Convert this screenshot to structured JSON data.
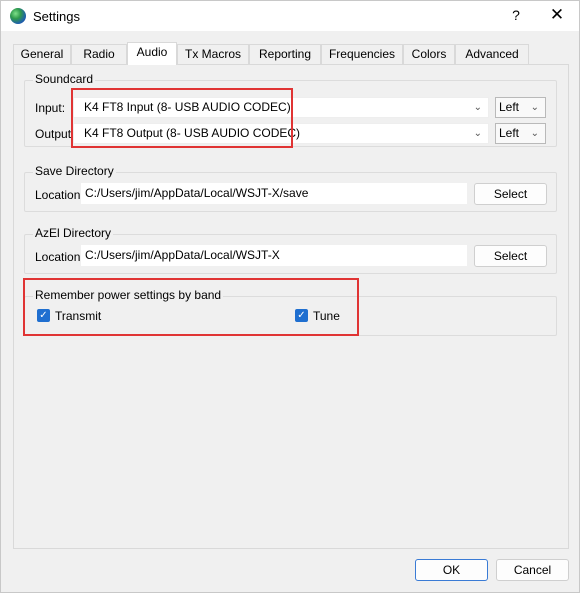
{
  "window": {
    "title": "Settings",
    "help": "?",
    "close": "✕"
  },
  "tabs": [
    {
      "label": "General"
    },
    {
      "label": "Radio"
    },
    {
      "label": "Audio"
    },
    {
      "label": "Tx Macros"
    },
    {
      "label": "Reporting"
    },
    {
      "label": "Frequencies"
    },
    {
      "label": "Colors"
    },
    {
      "label": "Advanced"
    }
  ],
  "active_tab": "Audio",
  "soundcard": {
    "title": "Soundcard",
    "input_label": "Input:",
    "input_value": "K4 FT8 Input (8- USB AUDIO  CODEC)",
    "input_channel": "Left",
    "output_label": "Output:",
    "output_value": "K4 FT8 Output (8- USB AUDIO  CODEC)",
    "output_channel": "Left"
  },
  "save_directory": {
    "title": "Save Directory",
    "location_label": "Location:",
    "path": "C:/Users/jim/AppData/Local/WSJT-X/save",
    "select_label": "Select"
  },
  "azel_directory": {
    "title": "AzEl Directory",
    "location_label": "Location:",
    "path": "C:/Users/jim/AppData/Local/WSJT-X",
    "select_label": "Select"
  },
  "power": {
    "title": "Remember power settings by band",
    "transmit_label": "Transmit",
    "transmit_checked": true,
    "tune_label": "Tune",
    "tune_checked": true
  },
  "footer": {
    "ok_label": "OK",
    "cancel_label": "Cancel"
  },
  "colors": {
    "accent": "#1f6fd0",
    "highlight_box": "#e03434"
  }
}
